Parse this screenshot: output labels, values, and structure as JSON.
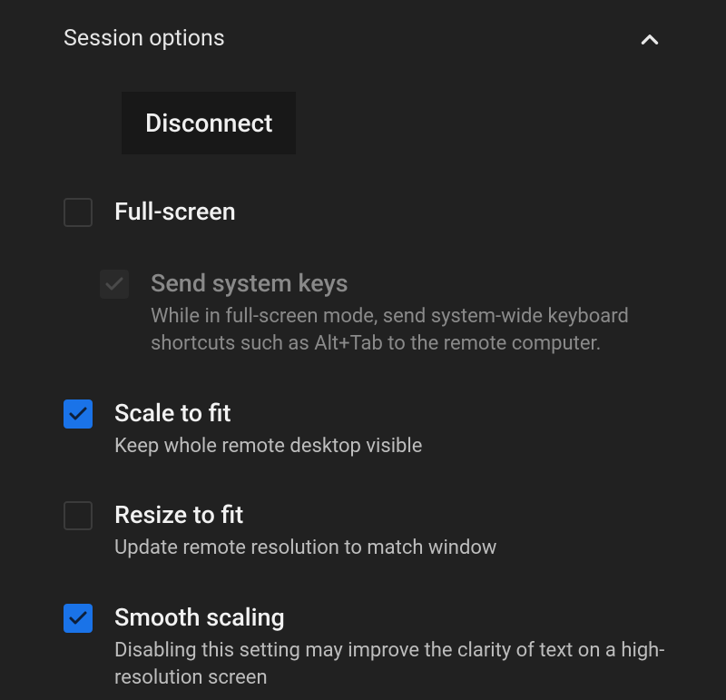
{
  "header": {
    "title": "Session options"
  },
  "disconnect": {
    "label": "Disconnect"
  },
  "options": {
    "fullscreen": {
      "label": "Full-screen"
    },
    "send_system_keys": {
      "label": "Send system keys",
      "desc": "While in full-screen mode, send system-wide keyboard shortcuts such as Alt+Tab to the remote computer."
    },
    "scale_to_fit": {
      "label": "Scale to fit",
      "desc": "Keep whole remote desktop visible"
    },
    "resize_to_fit": {
      "label": "Resize to fit",
      "desc": "Update remote resolution to match window"
    },
    "smooth_scaling": {
      "label": "Smooth scaling",
      "desc": "Disabling this setting may improve the clarity of text on a high-resolution screen"
    }
  }
}
